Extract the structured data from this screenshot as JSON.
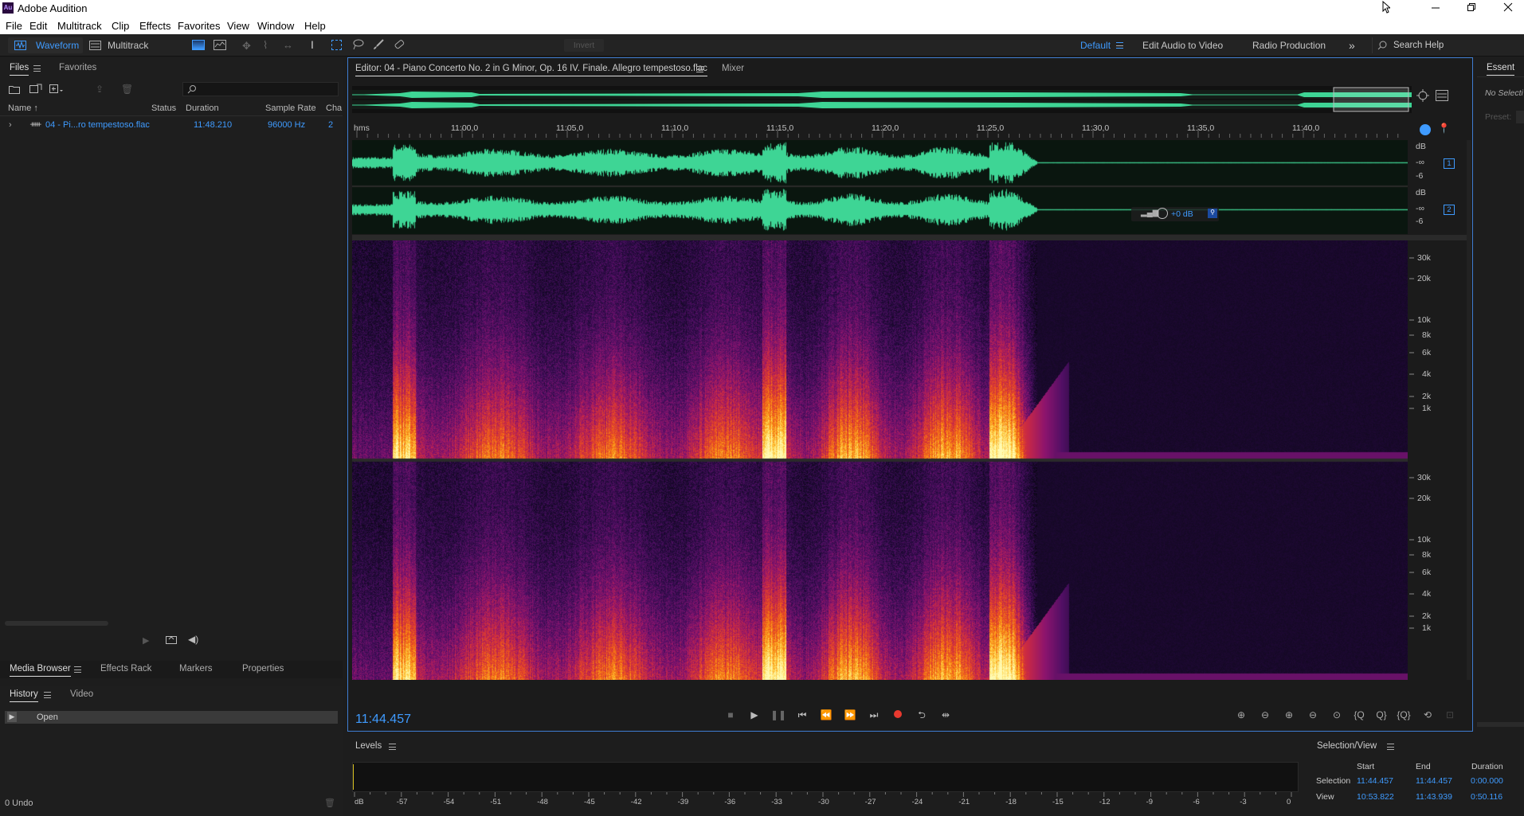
{
  "app": {
    "title": "Adobe Audition",
    "logo_text": "Au"
  },
  "menu": [
    "File",
    "Edit",
    "Multitrack",
    "Clip",
    "Effects",
    "Favorites",
    "View",
    "Window",
    "Help"
  ],
  "toolbar": {
    "waveform_label": "Waveform",
    "multitrack_label": "Multitrack",
    "invert_label": "Invert",
    "workspaces": [
      "Default",
      "Edit Audio to Video",
      "Radio Production"
    ],
    "active_workspace": "Default",
    "search_placeholder": "Search Help"
  },
  "files_panel": {
    "tabs": [
      "Files",
      "Favorites"
    ],
    "columns": [
      "Name",
      "Status",
      "Duration",
      "Sample Rate",
      "Cha"
    ],
    "rows": [
      {
        "name": "04 - Pi...ro tempestoso.flac",
        "status": "",
        "duration": "11:48.210",
        "sample_rate": "96000 Hz",
        "channels": "2"
      }
    ]
  },
  "bottom_tabs": [
    "Media Browser",
    "Effects Rack",
    "Markers",
    "Properties"
  ],
  "history": {
    "tabs": [
      "History",
      "Video"
    ],
    "items": [
      "Open"
    ],
    "undo_count": "0 Undo"
  },
  "editor": {
    "tab_label": "Editor: 04 - Piano Concerto No. 2 in G Minor, Op. 16 IV. Finale. Allegro tempestoso.flac",
    "mixer_label": "Mixer",
    "time_unit": "hms",
    "ruler_ticks": [
      "11:00,0",
      "11:05,0",
      "11:10,0",
      "11:15,0",
      "11:20,0",
      "11:25,0",
      "11:30,0",
      "11:35,0",
      "11:40,0"
    ],
    "db_labels": [
      "dB",
      "-∞",
      "-6"
    ],
    "channel_numbers": [
      "1",
      "2"
    ],
    "hud_volume": "+0 dB",
    "freq_labels": [
      "30k",
      "20k",
      "10k",
      "8k",
      "6k",
      "4k",
      "2k",
      "1k"
    ],
    "current_time": "11:44.457"
  },
  "essential": {
    "tab": "Essent",
    "no_selection": "No Selecti",
    "preset": "Preset:"
  },
  "levels": {
    "title": "Levels",
    "scale": [
      "dB",
      "-57",
      "-54",
      "-51",
      "-48",
      "-45",
      "-42",
      "-39",
      "-36",
      "-33",
      "-30",
      "-27",
      "-24",
      "-21",
      "-18",
      "-15",
      "-12",
      "-9",
      "-6",
      "-3",
      "0"
    ]
  },
  "selection_view": {
    "title": "Selection/View",
    "headers": [
      "Start",
      "End",
      "Duration"
    ],
    "rows": [
      {
        "label": "Selection",
        "start": "11:44.457",
        "end": "11:44.457",
        "duration": "0:00.000"
      },
      {
        "label": "View",
        "start": "10:53.822",
        "end": "11:43.939",
        "duration": "0:50.116"
      }
    ]
  },
  "colors": {
    "waveform": "#3ed595",
    "accent": "#3f9bff",
    "record": "#e8392f"
  }
}
